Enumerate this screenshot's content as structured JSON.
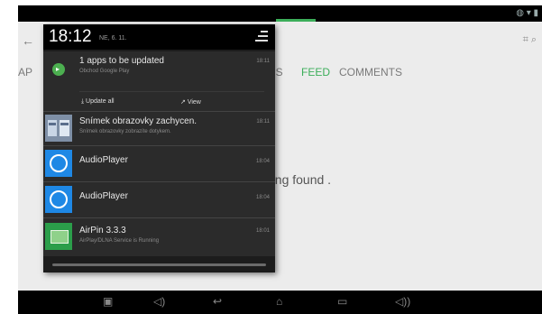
{
  "status_bar": {
    "icons": "◍ ▾ ▮"
  },
  "app_bar": {
    "back": "←",
    "right_icons": "⌗ ⌕"
  },
  "tabs": [
    {
      "label": "AP"
    },
    {
      "label": "RS"
    },
    {
      "label": "FEED"
    },
    {
      "label": "COMMENTS"
    }
  ],
  "main": {
    "empty_text": "...ing found ."
  },
  "shade": {
    "clock": "18:12",
    "date": "NE, 6. 11.",
    "notifications": [
      {
        "title": "1 apps to be updated",
        "subtitle": "Obchod Google Play",
        "time": "18:11",
        "actions": [
          {
            "label": "Update all"
          },
          {
            "label": "View"
          }
        ]
      },
      {
        "title": "Snímek obrazovky zachycen.",
        "subtitle": "Snímek obrazovky zobrazíte dotykem.",
        "time": "18:11"
      },
      {
        "title": "AudioPlayer",
        "subtitle": "",
        "time": "18:04"
      },
      {
        "title": "AudioPlayer",
        "subtitle": "",
        "time": "18:04"
      },
      {
        "title": "AirPin 3.3.3",
        "subtitle": "AirPlay/DLNA Service is Running",
        "time": "18:01"
      }
    ]
  },
  "navbar": {
    "icons": [
      {
        "name": "screenshot-icon",
        "glyph": "▣"
      },
      {
        "name": "volume-down-icon",
        "glyph": "◁)"
      },
      {
        "name": "back-icon",
        "glyph": "↩"
      },
      {
        "name": "home-icon",
        "glyph": "⌂"
      },
      {
        "name": "recents-icon",
        "glyph": "▭"
      },
      {
        "name": "volume-up-icon",
        "glyph": "◁))"
      }
    ]
  }
}
